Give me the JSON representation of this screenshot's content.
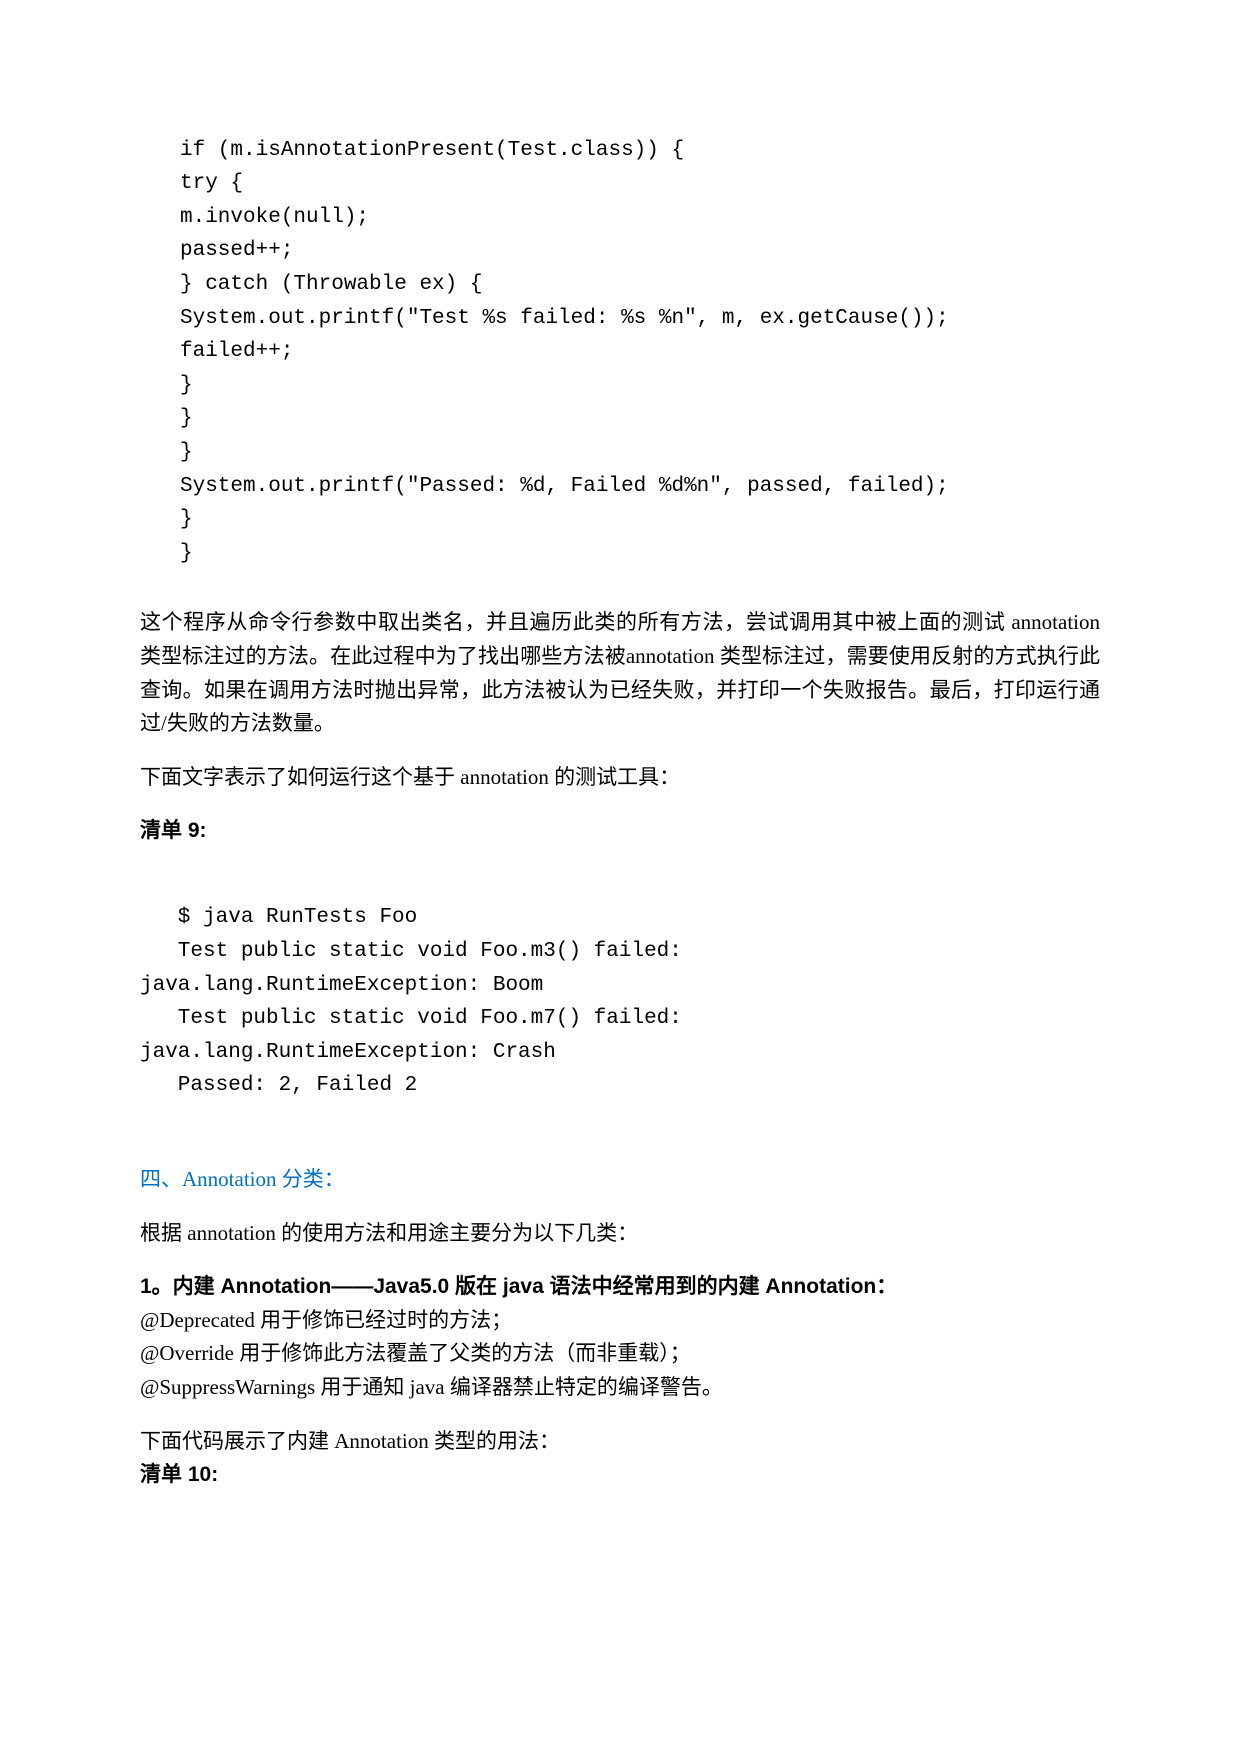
{
  "code1": {
    "l1": "if (m.isAnnotationPresent(Test.class)) {",
    "l2": "try {",
    "l3": "m.invoke(null);",
    "l4": "passed++;",
    "l5": "} catch (Throwable ex) {",
    "l6": "System.out.printf(\"Test %s failed: %s %n\", m, ex.getCause());",
    "l7": "failed++;",
    "l8": "}",
    "l9": "}",
    "l10": "}",
    "l11": "System.out.printf(\"Passed: %d, Failed %d%n\", passed, failed);",
    "l12": "}",
    "l13": "}"
  },
  "para1": "这个程序从命令行参数中取出类名，并且遍历此类的所有方法，尝试调用其中被上面的测试 annotation 类型标注过的方法。在此过程中为了找出哪些方法被annotation 类型标注过，需要使用反射的方式执行此查询。如果在调用方法时抛出异常，此方法被认为已经失败，并打印一个失败报告。最后，打印运行通过/失败的方法数量。",
  "para2": "下面文字表示了如何运行这个基于 annotation 的测试工具：",
  "heading1": "清单 9:",
  "code2": {
    "l1": "   $ java RunTests Foo",
    "l2": "   Test public static void Foo.m3() failed:",
    "l3": "java.lang.RuntimeException: Boom",
    "l4": "   Test public static void Foo.m7() failed:",
    "l5": "java.lang.RuntimeException: Crash",
    "l6": "   Passed: 2, Failed 2"
  },
  "heading2": "四、Annotation 分类：",
  "para3": "根据 annotation 的使用方法和用途主要分为以下几类：",
  "heading3": "1。内建 Annotation——Java5.0 版在 java 语法中经常用到的内建 Annotation：",
  "para4_l1": "@Deprecated 用于修饰已经过时的方法；",
  "para4_l2": "@Override 用于修饰此方法覆盖了父类的方法（而非重载）；",
  "para4_l3": "@SuppressWarnings 用于通知 java 编译器禁止特定的编译警告。",
  "para5": "下面代码展示了内建 Annotation 类型的用法：",
  "heading4": "清单 10:"
}
